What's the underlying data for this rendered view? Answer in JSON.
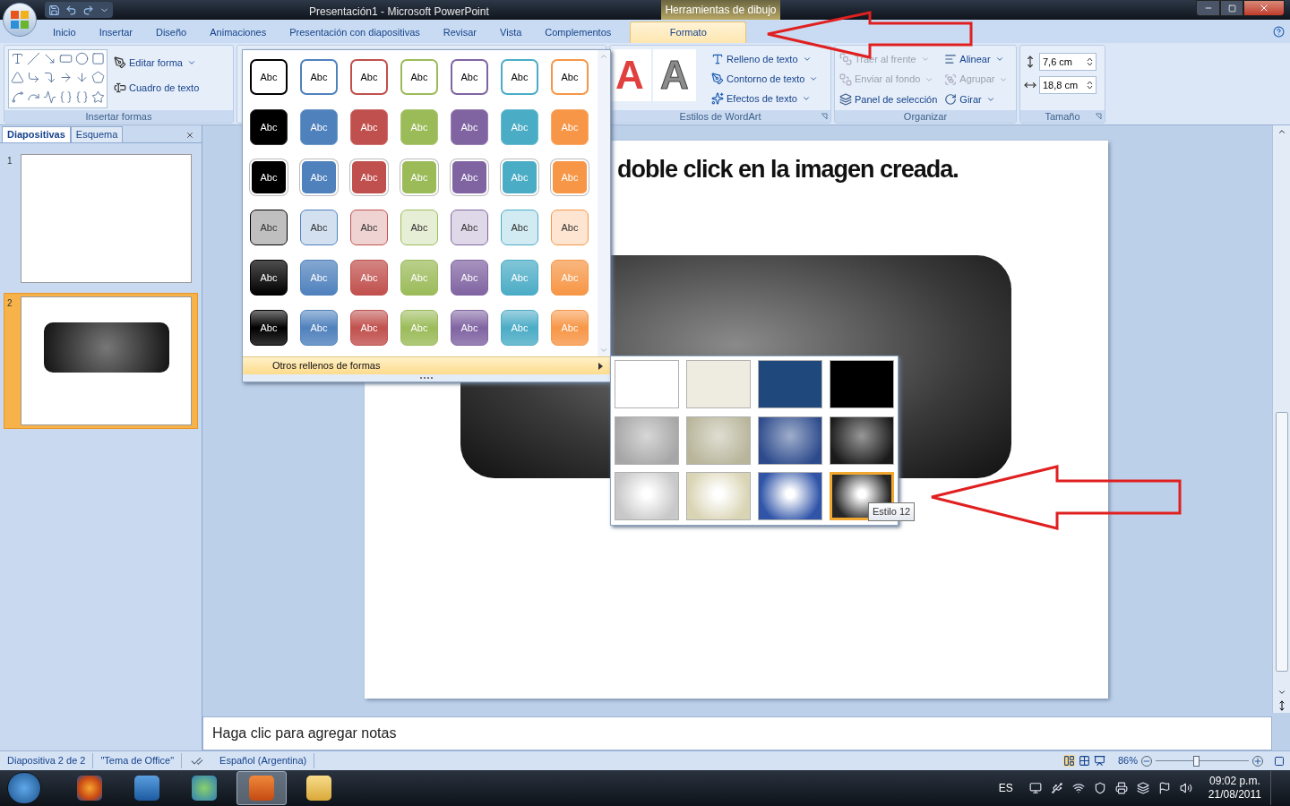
{
  "window": {
    "title": "Presentación1 - Microsoft PowerPoint",
    "context_group": "Herramientas de dibujo"
  },
  "ribbon_tabs": [
    {
      "label": "Inicio",
      "selected": false
    },
    {
      "label": "Insertar",
      "selected": false
    },
    {
      "label": "Diseño",
      "selected": false
    },
    {
      "label": "Animaciones",
      "selected": false
    },
    {
      "label": "Presentación con diapositivas",
      "selected": false
    },
    {
      "label": "Revisar",
      "selected": false
    },
    {
      "label": "Vista",
      "selected": false
    },
    {
      "label": "Complementos",
      "selected": false
    },
    {
      "label": "Formato",
      "selected": true
    }
  ],
  "ribbon": {
    "insert_shapes": {
      "label": "Insertar formas",
      "buttons": [
        {
          "label": "Editar forma",
          "dropdown": true
        },
        {
          "label": "Cuadro de texto",
          "dropdown": false
        }
      ]
    },
    "wordart": {
      "label": "Estilos de WordArt",
      "samples": [
        "A",
        "A"
      ],
      "buttons": [
        {
          "label": "Relleno de texto",
          "dropdown": true
        },
        {
          "label": "Contorno de texto",
          "dropdown": true
        },
        {
          "label": "Efectos de texto",
          "dropdown": true
        }
      ]
    },
    "organize": {
      "label": "Organizar",
      "items": [
        {
          "label": "Traer al frente",
          "disabled": true,
          "dropdown": true
        },
        {
          "label": "Enviar al fondo",
          "disabled": true,
          "dropdown": true
        },
        {
          "label": "Panel de selección",
          "disabled": false,
          "dropdown": false
        },
        {
          "label": "Alinear",
          "disabled": false,
          "dropdown": true
        },
        {
          "label": "Agrupar",
          "disabled": true,
          "dropdown": true
        },
        {
          "label": "Girar",
          "disabled": false,
          "dropdown": true
        }
      ]
    },
    "size": {
      "label": "Tamaño",
      "height": "7,6 cm",
      "width": "18,8 cm"
    }
  },
  "slide_panel": {
    "tabs": [
      {
        "label": "Diapositivas",
        "selected": true
      },
      {
        "label": "Esquema",
        "selected": false
      }
    ],
    "slides": [
      {
        "number": "1",
        "selected": false,
        "has_shape": false
      },
      {
        "number": "2",
        "selected": true,
        "has_shape": true
      }
    ]
  },
  "slide": {
    "title": "doble click en la imagen creada."
  },
  "notes": {
    "placeholder": "Haga clic para agregar notas"
  },
  "shape_styles_gallery": {
    "columns": [
      {
        "color": "#000000"
      },
      {
        "color": "#4f81bd"
      },
      {
        "color": "#c0504d"
      },
      {
        "color": "#9bbb59"
      },
      {
        "color": "#8064a2"
      },
      {
        "color": "#4bacc6"
      },
      {
        "color": "#f79646"
      }
    ],
    "rows": [
      {
        "kind": "outline",
        "labels": [
          "Abc",
          "Abc",
          "Abc",
          "Abc",
          "Abc",
          "Abc",
          "Abc"
        ]
      },
      {
        "kind": "solid",
        "labels": [
          "Abc",
          "Abc",
          "Abc",
          "Abc",
          "Abc",
          "Abc",
          "Abc"
        ]
      },
      {
        "kind": "solid_white_border",
        "labels": [
          "Abc",
          "Abc",
          "Abc",
          "Abc",
          "Abc",
          "Abc",
          "Abc"
        ]
      },
      {
        "kind": "light",
        "labels": [
          "Abc",
          "Abc",
          "Abc",
          "Abc",
          "Abc",
          "Abc",
          "Abc"
        ]
      },
      {
        "kind": "gradient",
        "labels": [
          "Abc",
          "Abc",
          "Abc",
          "Abc",
          "Abc",
          "Abc",
          "Abc"
        ]
      },
      {
        "kind": "glossy",
        "labels": [
          "Abc",
          "Abc",
          "Abc",
          "Abc",
          "Abc",
          "Abc",
          "Abc"
        ]
      }
    ],
    "menu_item": "Otros rellenos de formas"
  },
  "texture_gallery": {
    "swatches": [
      {
        "kind": "flat",
        "color": "#ffffff",
        "selected": false
      },
      {
        "kind": "flat",
        "color": "#eeece1",
        "selected": false
      },
      {
        "kind": "flat",
        "color": "#1f497d",
        "selected": false
      },
      {
        "kind": "flat",
        "color": "#000000",
        "selected": false
      },
      {
        "kind": "gradient",
        "color": "#a6a6a6",
        "selected": false
      },
      {
        "kind": "gradient",
        "color": "#b8b59a",
        "selected": false
      },
      {
        "kind": "gradient",
        "color": "#2c4a8c",
        "selected": false
      },
      {
        "kind": "gradient",
        "color": "#1a1a1a",
        "selected": false
      },
      {
        "kind": "glow",
        "color": "#c8c8c8",
        "selected": false
      },
      {
        "kind": "glow",
        "color": "#d9d4b4",
        "selected": false
      },
      {
        "kind": "glow",
        "color": "#2f54a8",
        "selected": false
      },
      {
        "kind": "glow",
        "color": "#262626",
        "selected": true
      }
    ],
    "tooltip": "Estilo 12"
  },
  "status_bar": {
    "slide": "Diapositiva 2 de 2",
    "theme": "\"Tema de Office\"",
    "language": "Español (Argentina)",
    "zoom": "86%",
    "zoom_slider": {
      "level": 0.43
    }
  },
  "taskbar": {
    "language": "ES",
    "time": "09:02 p.m.",
    "date": "21/08/2011"
  }
}
